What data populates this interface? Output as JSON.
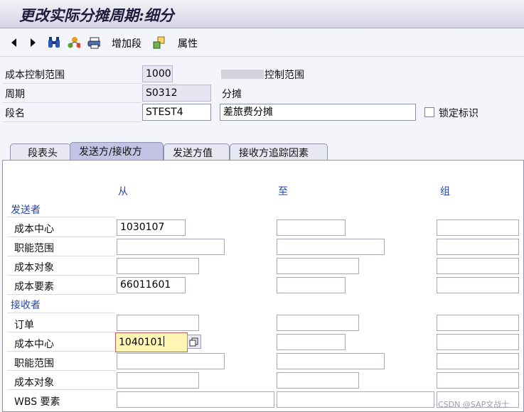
{
  "window": {
    "title": "更改实际分摊周期:细分"
  },
  "toolbar": {
    "add_segment": "增加段",
    "attributes": "属性",
    "icons": [
      "arrow-left-icon",
      "arrow-right-icon",
      "binoculars-icon",
      "hierarchy-icon",
      "print-icon",
      "segment-icon"
    ]
  },
  "header": {
    "controlling_area_label": "成本控制范围",
    "controlling_area_value": "1000",
    "controlling_area_desc": "控制范围",
    "period_label": "周期",
    "period_value": "S0312",
    "period_desc": "分摊",
    "segment_label": "段名",
    "segment_value": "STEST4",
    "segment_desc": "差旅费分摊",
    "lock_label": "锁定标识"
  },
  "tabs": [
    "段表头",
    "发送方/接收方",
    "发送方值",
    "接收方追踪因素"
  ],
  "grid": {
    "col_from": "从",
    "col_to": "至",
    "col_group": "组",
    "sender_section": "发送者",
    "receiver_section": "接收者",
    "sender_rows": [
      {
        "label": "成本中心",
        "from": "1030107",
        "to": "",
        "group": ""
      },
      {
        "label": "职能范围",
        "from": "",
        "to": "",
        "group": ""
      },
      {
        "label": "成本对象",
        "from": "",
        "to": "",
        "group": ""
      },
      {
        "label": "成本要素",
        "from": "66011601",
        "to": "",
        "group": ""
      }
    ],
    "receiver_rows": [
      {
        "label": "订单",
        "from": "",
        "to": "",
        "group": ""
      },
      {
        "label": "成本中心",
        "from": "1040101",
        "to": "",
        "group": ""
      },
      {
        "label": "职能范围",
        "from": "",
        "to": "",
        "group": ""
      },
      {
        "label": "成本对象",
        "from": "",
        "to": "",
        "group": ""
      },
      {
        "label": "WBS 要素",
        "from": "",
        "to": "",
        "group": ""
      }
    ]
  },
  "watermark": "CSDN @SAP文战士"
}
